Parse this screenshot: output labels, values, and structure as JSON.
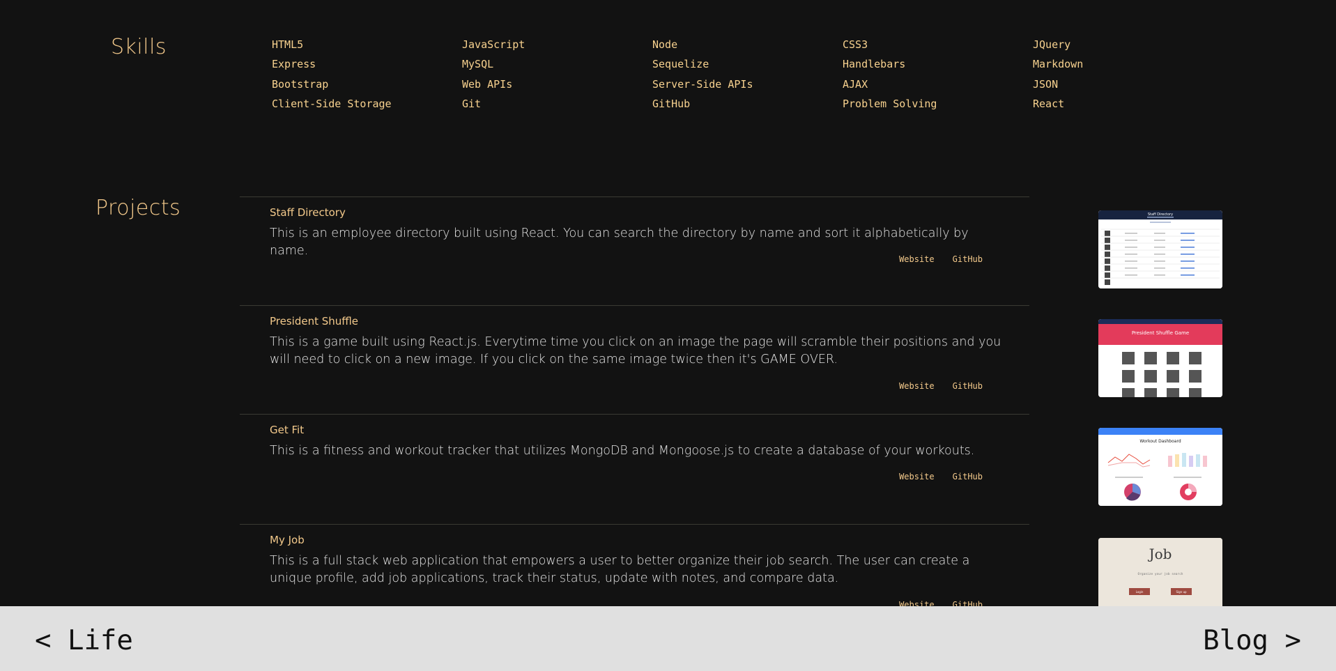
{
  "skills": {
    "title": "Skills",
    "items": [
      "HTML5",
      "JavaScript",
      "Node",
      "CSS3",
      "JQuery",
      "Express",
      "MySQL",
      "Sequelize",
      "Handlebars",
      "Markdown",
      "Bootstrap",
      "Web APIs",
      "Server-Side APIs",
      "AJAX",
      "JSON",
      "Client-Side Storage",
      "Git",
      "GitHub",
      "Problem Solving",
      "React"
    ]
  },
  "projects": {
    "title": "Projects",
    "items": [
      {
        "name": "Staff Directory",
        "description": "This is an employee directory built using React. You can search the directory by name and sort it alphabetically by name.",
        "website_label": "Website",
        "github_label": "GitHub",
        "thumb_title": "Staff Directory"
      },
      {
        "name": "President Shuffle",
        "description": "This is a game built using React.js. Everytime time you click on an image the page will scramble their positions and you will need to click on a new image. If you click on the same image twice then it's GAME OVER.",
        "website_label": "Website",
        "github_label": "GitHub",
        "thumb_title": "President Shuffle Game"
      },
      {
        "name": "Get Fit",
        "description": "This is a fitness and workout tracker that utilizes MongoDB and Mongoose.js to create a database of your workouts.",
        "website_label": "Website",
        "github_label": "GitHub",
        "thumb_title": "Workout Dashboard"
      },
      {
        "name": "My Job",
        "description": "This is a full stack web application that empowers a user to better organize their job search. The user can create a unique profile, add job applications, track their status, update with notes, and compare data.",
        "website_label": "Website",
        "github_label": "GitHub",
        "thumb_title": "Job",
        "thumb_subtitle": "Organize your job search",
        "thumb_btn1": "Login",
        "thumb_btn2": "Sign up"
      }
    ]
  },
  "footer": {
    "prev_label": "< Life",
    "next_label": "Blog >"
  },
  "colors": {
    "background": "#121212",
    "accent": "#f3c98b",
    "footer_bg": "#e0e0e0"
  }
}
